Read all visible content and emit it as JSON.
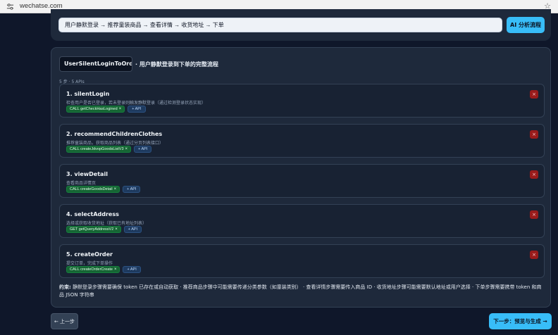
{
  "browser": {
    "url": "wechatse.com",
    "tune_icon": "tune-icon",
    "star_icon": "star-icon"
  },
  "input_panel": {
    "flow_text": "用户静默登录 → 推荐童装商品 → 查看详情 → 收货地址 → 下单",
    "analyze_button": "AI 分析流程"
  },
  "flow": {
    "name": "UserSilentLoginToOrde",
    "description": "· 用户静默登录到下单的完整流程",
    "meta": "5 步 · 5 APIs",
    "steps": [
      {
        "title": "1. silentLogin",
        "desc": "检查用户是否已登录，若未登录则触发静默登录（通过检测登录状态实现）",
        "tag": "CALL getCheckHasLogined",
        "tag_x": "×",
        "add": "+ API",
        "del": "×"
      },
      {
        "title": "2. recommendChildrenClothes",
        "desc": "推荐童装商品，获取商品列表（通过分页列表接口）",
        "tag": "CALL createJdvopGoodsListV3",
        "tag_x": "×",
        "add": "+ API",
        "del": "×"
      },
      {
        "title": "3. viewDetail",
        "desc": "查看商品详情页",
        "tag": "CALL createGoodsDetail",
        "tag_x": "×",
        "add": "+ API",
        "del": "×"
      },
      {
        "title": "4. selectAddress",
        "desc": "选择或获取收货地址（获取已有地址列表）",
        "tag": "GET getQueryAddressV2",
        "tag_x": "×",
        "add": "+ API",
        "del": "×"
      },
      {
        "title": "5. createOrder",
        "desc": "提交订单，完成下单操作",
        "tag": "CALL createOrderCreate",
        "tag_x": "×",
        "add": "+ API",
        "del": "×"
      }
    ],
    "constraints_label": "约束:",
    "constraints_text": "静默登录步骤需要确保 token 已存在或自动获取 · 推荐商品步骤中可能需要传递分类参数（如童装类别） · 查看详情步骤需要传入商品 ID · 收货地址步骤可能需要默认地址或用户选择 · 下单步骤需要携带 token 和商品 JSON 字符串"
  },
  "nav": {
    "prev": "← 上一步",
    "next": "下一步：预览与生成 →"
  },
  "colors": {
    "accent": "#38bdf8",
    "background": "#0f172a",
    "panel": "#1e293b",
    "call_tag": "#166534",
    "delete": "#991b1b"
  }
}
